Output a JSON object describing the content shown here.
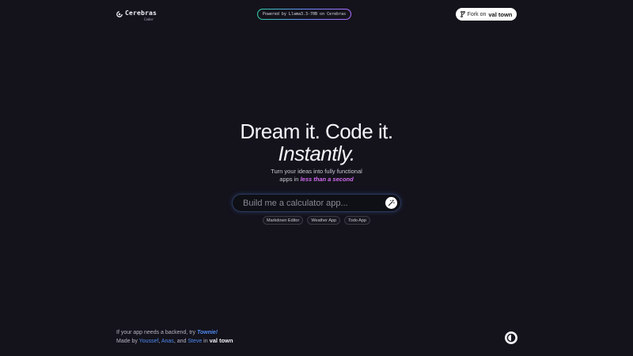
{
  "header": {
    "logo_name": "Cerebras",
    "logo_sub": "Coder",
    "powered_by": "Powered by Llama3.3-70B on Cerebras",
    "fork_label": "Fork on",
    "fork_brand": "val town"
  },
  "hero": {
    "line1": "Dream it. Code it.",
    "line2": "Instantly."
  },
  "subtitle": {
    "line1": "Turn your ideas into fully functional",
    "line2_prefix": "apps in ",
    "line2_accent": "less than a second"
  },
  "prompt": {
    "placeholder": "Build me a calculator app...",
    "value": ""
  },
  "suggestions": [
    "Markdown Editor",
    "Weather App",
    "Todo App"
  ],
  "footer": {
    "line1_prefix": "If your app needs a backend, try ",
    "line1_link": "Townie!",
    "made_by": "Made by ",
    "author1": "Youssef",
    "sep1": ", ",
    "author2": "Anas",
    "sep2": ", and ",
    "author3": "Steve",
    "in": " in ",
    "brand": "val town"
  },
  "colors": {
    "background": "#14131c",
    "accent_pink": "#d46cf0",
    "link_blue": "#4f8af0"
  }
}
